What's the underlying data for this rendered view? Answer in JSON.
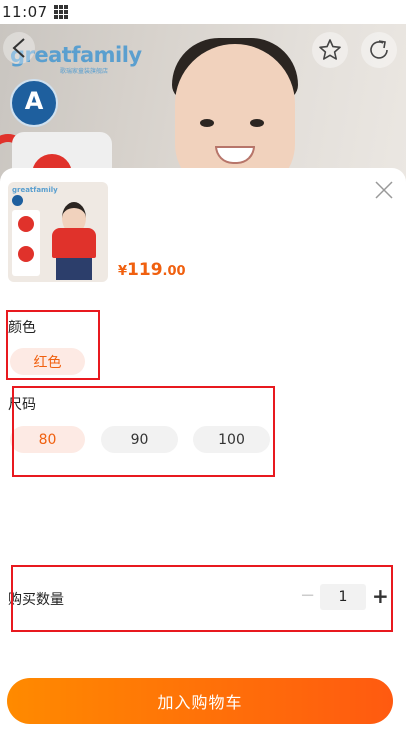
{
  "status_bar": {
    "time": "11:07"
  },
  "hero": {
    "brand": "greatfamily",
    "brand_sub": "歌瑞家童装旗舰店",
    "badge": "A"
  },
  "product": {
    "thumb_brand": "greatfamily",
    "price_currency": "¥",
    "price_int": "119",
    "price_dec": ".00"
  },
  "color": {
    "label": "颜色",
    "options": [
      {
        "label": "红色",
        "selected": true
      }
    ]
  },
  "size": {
    "label": "尺码",
    "options": [
      {
        "label": "80",
        "selected": true
      },
      {
        "label": "90",
        "selected": false
      },
      {
        "label": "100",
        "selected": false
      }
    ]
  },
  "quantity": {
    "label": "购买数量",
    "value": "1",
    "minus": "−",
    "plus": "+"
  },
  "cta": {
    "label": "加入购物车"
  },
  "colors": {
    "accent": "#f0600f",
    "highlight": "#e8191f",
    "cta_start": "#ff8a00",
    "cta_end": "#ff5a10"
  }
}
